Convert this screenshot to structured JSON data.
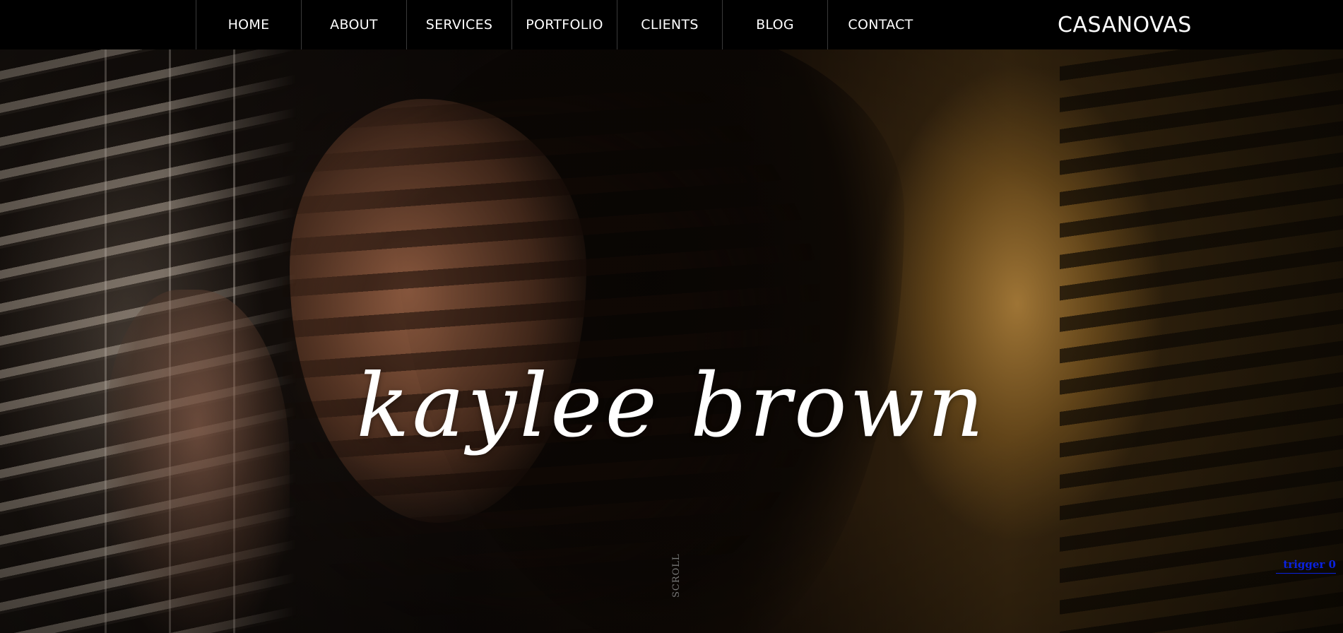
{
  "nav": {
    "items": [
      {
        "label": "HOME"
      },
      {
        "label": "ABOUT"
      },
      {
        "label": "SERVICES"
      },
      {
        "label": "PORTFOLIO"
      },
      {
        "label": "CLIENTS"
      },
      {
        "label": "BLOG"
      },
      {
        "label": "CONTACT"
      }
    ],
    "brand": "CASANOVAS"
  },
  "hero": {
    "title": "kaylee brown",
    "scroll_label": "SCROLL",
    "trigger_link": "trigger 0",
    "image": "woman-peering-through-window-blinds-photo"
  },
  "colors": {
    "nav_background": "#000000",
    "nav_text": "#ffffff",
    "link_blue": "#0a22e0"
  }
}
